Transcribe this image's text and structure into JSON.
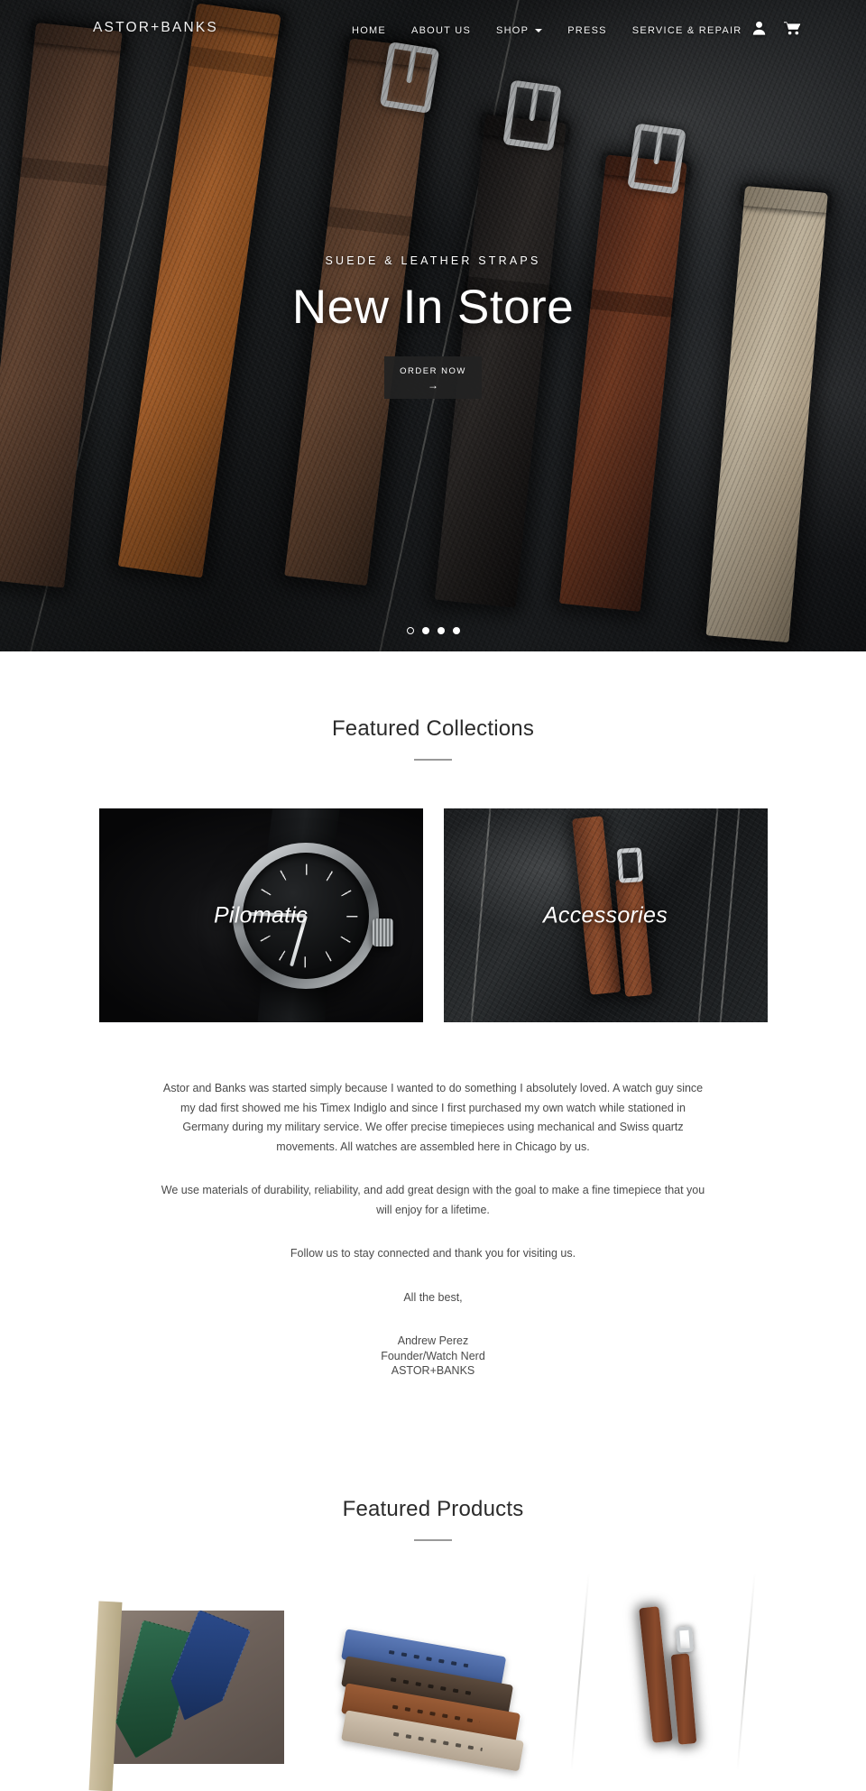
{
  "site": {
    "logo": "ASTOR+BANKS"
  },
  "nav": {
    "items": [
      {
        "label": "HOME",
        "has_dropdown": false
      },
      {
        "label": "ABOUT US",
        "has_dropdown": false
      },
      {
        "label": "SHOP",
        "has_dropdown": true
      },
      {
        "label": "PRESS",
        "has_dropdown": false
      },
      {
        "label": "SERVICE & REPAIR",
        "has_dropdown": false
      }
    ],
    "account_icon": "user-icon",
    "cart_icon": "shopping-cart-icon"
  },
  "hero": {
    "eyebrow": "SUEDE & LEATHER STRAPS",
    "title": "New In Store",
    "cta_label": "ORDER NOW",
    "cta_arrow": "→",
    "slide_count": 4,
    "active_slide": 1
  },
  "collections": {
    "title": "Featured Collections",
    "cards": [
      {
        "label": "Pilomatic",
        "art": "watch"
      },
      {
        "label": "Accessories",
        "art": "strap-on-leather"
      }
    ]
  },
  "about": {
    "paragraphs": [
      "Astor and Banks was started simply because I wanted to do something I absolutely loved. A watch guy since my dad first showed me his Timex Indiglo and since I first purchased my own watch while stationed in Germany during my military service. We offer precise timepieces using mechanical and Swiss quartz movements. All watches are assembled here in Chicago by us.",
      "We use materials of durability, reliability, and add great design with the goal to make a fine timepiece that you will enjoy for a lifetime.",
      "Follow us to stay connected and thank you for visiting us.",
      "All the best,"
    ],
    "signature": {
      "name": "Andrew Perez",
      "role": "Founder/Watch Nerd",
      "company": "ASTOR+BANKS"
    }
  },
  "products": {
    "title": "Featured Products",
    "items": [
      {
        "art": "leather-pouches"
      },
      {
        "art": "suede-straps"
      },
      {
        "art": "brown-strap-dark-leather"
      }
    ]
  },
  "colors": {
    "accent_dark": "#222222",
    "text_body": "#4a4a4a",
    "heading": "#2b2b2b",
    "rule": "#9a9a9a",
    "nav_text": "#f4f4f4"
  }
}
